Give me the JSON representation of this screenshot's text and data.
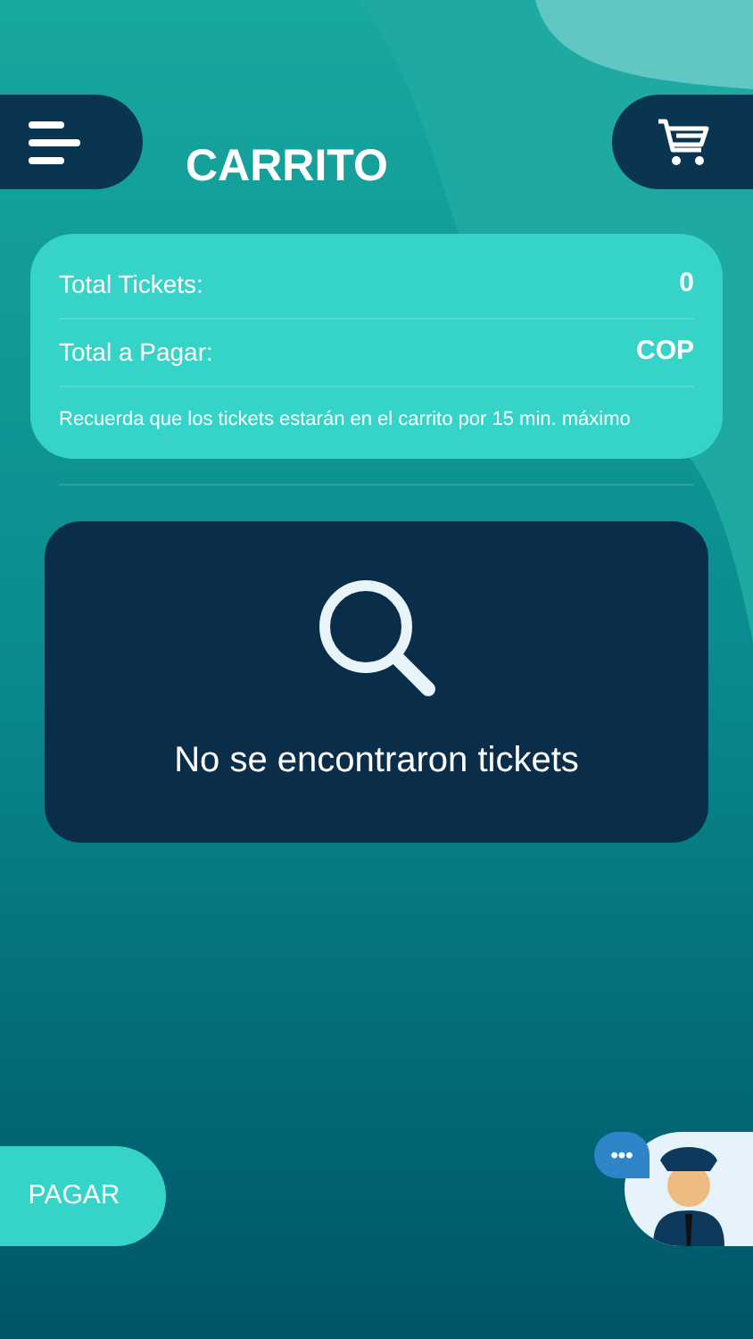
{
  "header": {
    "title": "CARRITO"
  },
  "summary": {
    "rows": [
      {
        "label": "Total Tickets:",
        "value": "0"
      },
      {
        "label": "Total a Pagar:",
        "value": "COP"
      }
    ],
    "note": "Recuerda que los tickets estarán en el carrito por 15 min. máximo"
  },
  "empty_state": {
    "message": "No se encontraron tickets"
  },
  "pay_button": {
    "label": "PAGAR"
  },
  "chat_bubble": {
    "label": "•••"
  }
}
